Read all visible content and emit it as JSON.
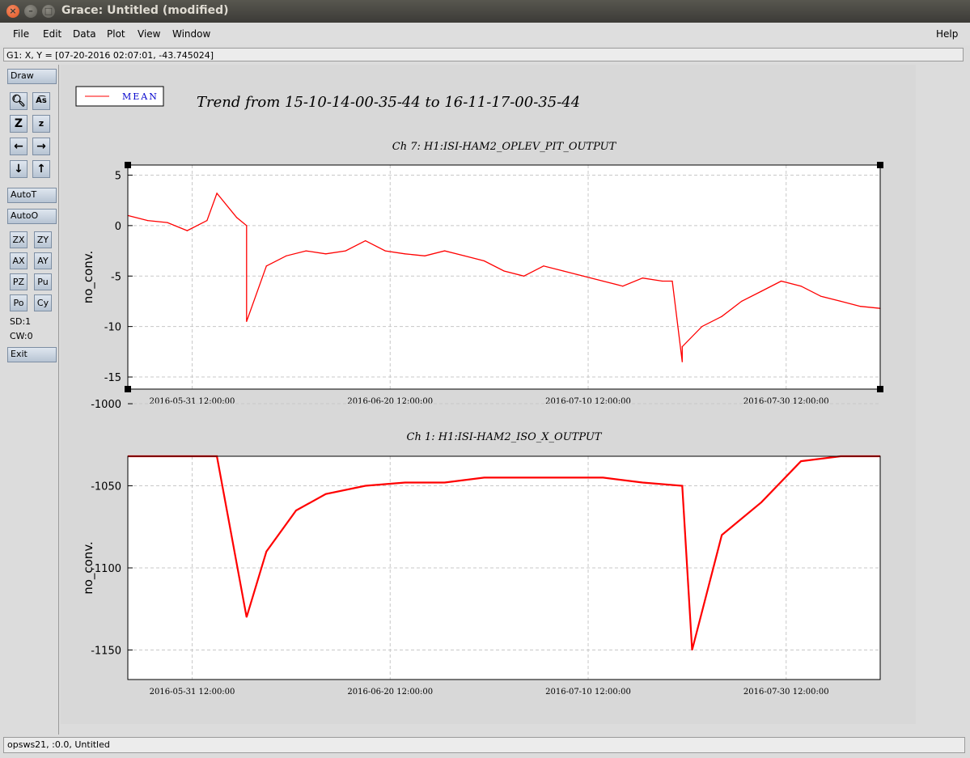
{
  "window": {
    "title": "Grace: Untitled (modified)"
  },
  "menubar": {
    "items": [
      "File",
      "Edit",
      "Data",
      "Plot",
      "View",
      "Window"
    ],
    "help": "Help"
  },
  "location": "G1: X, Y = [07-20-2016 02:07:01, -43.745024]",
  "toolbar": {
    "draw": "Draw",
    "autot": "AutoT",
    "autoo": "AutoO",
    "zx": "ZX",
    "zy": "ZY",
    "ax": "AX",
    "ay": "AY",
    "pz": "PZ",
    "pu": "Pu",
    "po": "Po",
    "cy": "Cy",
    "sd": "SD:1",
    "cw": "CW:0",
    "exit": "Exit"
  },
  "status": "opsws21, :0.0, Untitled",
  "colors": {
    "series": "#ff0000",
    "legend_text": "#0000cc"
  },
  "chart_data": [
    {
      "type": "line",
      "title": "Trend from 15-10-14-00-35-44 to 16-11-17-00-35-44",
      "subtitle": "Ch 7: H1:ISI-HAM2_OPLEV_PIT_OUTPUT",
      "ylabel": "no_conv.",
      "ylim": [
        -16.2,
        6
      ],
      "yticks": [
        5,
        0,
        -5,
        -10,
        -15
      ],
      "xlim": [
        "2016-05-25 00:00:00",
        "2016-08-09 00:00:00"
      ],
      "xticks": [
        "2016-05-31 12:00:00",
        "2016-06-20 12:00:00",
        "2016-07-10 12:00:00",
        "2016-07-30 12:00:00"
      ],
      "grid": true,
      "legend": "top-left",
      "series": [
        {
          "name": "MEAN",
          "x": [
            "2016-05-25",
            "2016-05-27",
            "2016-05-29",
            "2016-05-31",
            "2016-06-02",
            "2016-06-03",
            "2016-06-05",
            "2016-06-06",
            "2016-06-06",
            "2016-06-08",
            "2016-06-10",
            "2016-06-12",
            "2016-06-14",
            "2016-06-16",
            "2016-06-18",
            "2016-06-20",
            "2016-06-22",
            "2016-06-24",
            "2016-06-26",
            "2016-06-28",
            "2016-06-30",
            "2016-07-02",
            "2016-07-04",
            "2016-07-06",
            "2016-07-08",
            "2016-07-10",
            "2016-07-12",
            "2016-07-14",
            "2016-07-16",
            "2016-07-18",
            "2016-07-19",
            "2016-07-20",
            "2016-07-20",
            "2016-07-22",
            "2016-07-24",
            "2016-07-26",
            "2016-07-28",
            "2016-07-30",
            "2016-08-01",
            "2016-08-03",
            "2016-08-05",
            "2016-08-07",
            "2016-08-09"
          ],
          "y": [
            1,
            0.5,
            0.3,
            -0.5,
            0.5,
            3.2,
            0.8,
            0,
            -9.5,
            -4,
            -3,
            -2.5,
            -2.8,
            -2.5,
            -1.5,
            -2.5,
            -2.8,
            -3,
            -2.5,
            -3,
            -3.5,
            -4.5,
            -5,
            -4,
            -4.5,
            -5,
            -5.5,
            -6,
            -5.2,
            -5.5,
            -5.5,
            -13.5,
            -12,
            -10,
            -9,
            -7.5,
            -6.5,
            -5.5,
            -6,
            -7,
            -7.5,
            -8,
            -8.2
          ]
        }
      ]
    },
    {
      "type": "line",
      "subtitle": "Ch 1: H1:ISI-HAM2_ISO_X_OUTPUT",
      "ylabel": "no_conv.",
      "ylim": [
        -1168,
        -1032
      ],
      "yticks": [
        -1000,
        -1050,
        -1100,
        -1150
      ],
      "xlim": [
        "2016-05-25 00:00:00",
        "2016-08-09 00:00:00"
      ],
      "xticks": [
        "2016-05-31 12:00:00",
        "2016-06-20 12:00:00",
        "2016-07-10 12:00:00",
        "2016-07-30 12:00:00"
      ],
      "grid": true,
      "series": [
        {
          "x": [
            "2016-05-25",
            "2016-05-28",
            "2016-06-01",
            "2016-06-03",
            "2016-06-06",
            "2016-06-08",
            "2016-06-11",
            "2016-06-14",
            "2016-06-18",
            "2016-06-22",
            "2016-06-26",
            "2016-06-30",
            "2016-07-04",
            "2016-07-08",
            "2016-07-12",
            "2016-07-16",
            "2016-07-20",
            "2016-07-21",
            "2016-07-24",
            "2016-07-28",
            "2016-08-01",
            "2016-08-05",
            "2016-08-09"
          ],
          "y": [
            -1030,
            -1030,
            -1030,
            -1030,
            -1130,
            -1090,
            -1065,
            -1055,
            -1050,
            -1048,
            -1048,
            -1045,
            -1045,
            -1045,
            -1045,
            -1048,
            -1050,
            -1150,
            -1080,
            -1060,
            -1035,
            -1020,
            -1005
          ]
        }
      ]
    }
  ]
}
